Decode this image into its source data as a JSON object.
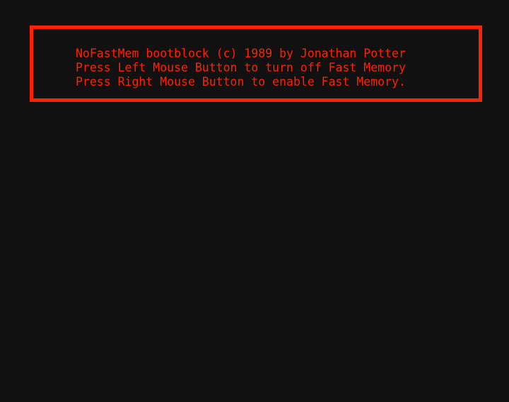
{
  "colors": {
    "background": "#111111",
    "accent": "#ff2200"
  },
  "alert": {
    "lines": [
      "NoFastMem bootblock (c) 1989 by Jonathan Potter",
      "Press Left Mouse Button to turn off Fast Memory",
      "Press Right Mouse Button to enable Fast Memory."
    ]
  }
}
